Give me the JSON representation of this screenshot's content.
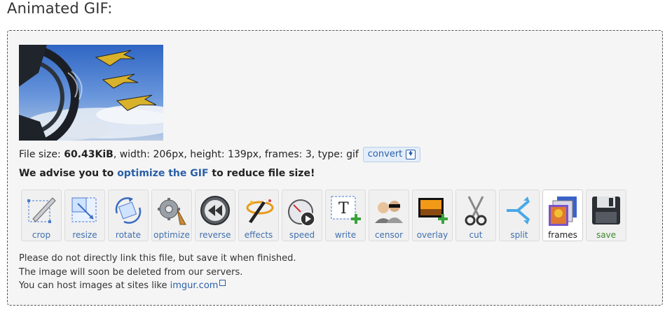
{
  "page": {
    "title": "Animated GIF:"
  },
  "file_info": {
    "prefix": "File size: ",
    "size": "60.43KiB",
    "details": ", width: 206px, height: 139px, frames: 3, type: gif",
    "convert_label": "convert"
  },
  "advise": {
    "before": "We advise you to ",
    "link": "optimize the GIF",
    "after": " to reduce file size!"
  },
  "tools": [
    {
      "label": "crop",
      "icon": "crop-icon"
    },
    {
      "label": "resize",
      "icon": "resize-icon"
    },
    {
      "label": "rotate",
      "icon": "rotate-icon"
    },
    {
      "label": "optimize",
      "icon": "optimize-icon"
    },
    {
      "label": "reverse",
      "icon": "reverse-icon"
    },
    {
      "label": "effects",
      "icon": "effects-icon"
    },
    {
      "label": "speed",
      "icon": "speed-icon"
    },
    {
      "label": "write",
      "icon": "write-icon"
    },
    {
      "label": "censor",
      "icon": "censor-icon"
    },
    {
      "label": "overlay",
      "icon": "overlay-icon"
    },
    {
      "label": "cut",
      "icon": "cut-icon"
    },
    {
      "label": "split",
      "icon": "split-icon"
    },
    {
      "label": "frames",
      "icon": "frames-icon"
    },
    {
      "label": "save",
      "icon": "save-icon"
    }
  ],
  "active_tool": "frames",
  "notes": {
    "line1": "Please do not directly link this file, but save it when finished.",
    "line2": "The image will soon be deleted from our servers.",
    "line3_before": "You can host images at sites like ",
    "line3_link": "imgur.com"
  },
  "colors": {
    "link": "#2a5fa8",
    "save": "#3b8a2a",
    "panel_bg": "#f5f5f5"
  }
}
